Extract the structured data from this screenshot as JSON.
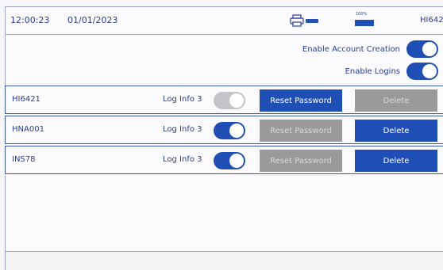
{
  "status": {
    "time": "12:00:23",
    "date": "01/01/2023",
    "battery_label": "100%",
    "user": "HI642"
  },
  "settings": [
    {
      "label": "Enable Account Creation",
      "enabled": true
    },
    {
      "label": "Enable Logins",
      "enabled": true
    }
  ],
  "users": [
    {
      "name": "HI6421",
      "log_info": "Log Info 3",
      "toggle_on": false,
      "reset_label": "Reset Password",
      "reset_enabled": true,
      "delete_label": "Delete",
      "delete_enabled": false
    },
    {
      "name": "HNA001",
      "log_info": "Log Info 3",
      "toggle_on": true,
      "reset_label": "Reset Password",
      "reset_enabled": false,
      "delete_label": "Delete",
      "delete_enabled": true
    },
    {
      "name": "INS78",
      "log_info": "Log Info 3",
      "toggle_on": true,
      "reset_label": "Reset Password",
      "reset_enabled": false,
      "delete_label": "Delete",
      "delete_enabled": true
    }
  ],
  "colors": {
    "accent": "#1f4fb5",
    "text": "#2a3c8f",
    "disabled": "#9a9a9c",
    "toggle_off": "#c2c4c8"
  },
  "icons": {
    "printer": "printer-icon",
    "pen": "pen-icon",
    "battery": "battery-icon"
  }
}
